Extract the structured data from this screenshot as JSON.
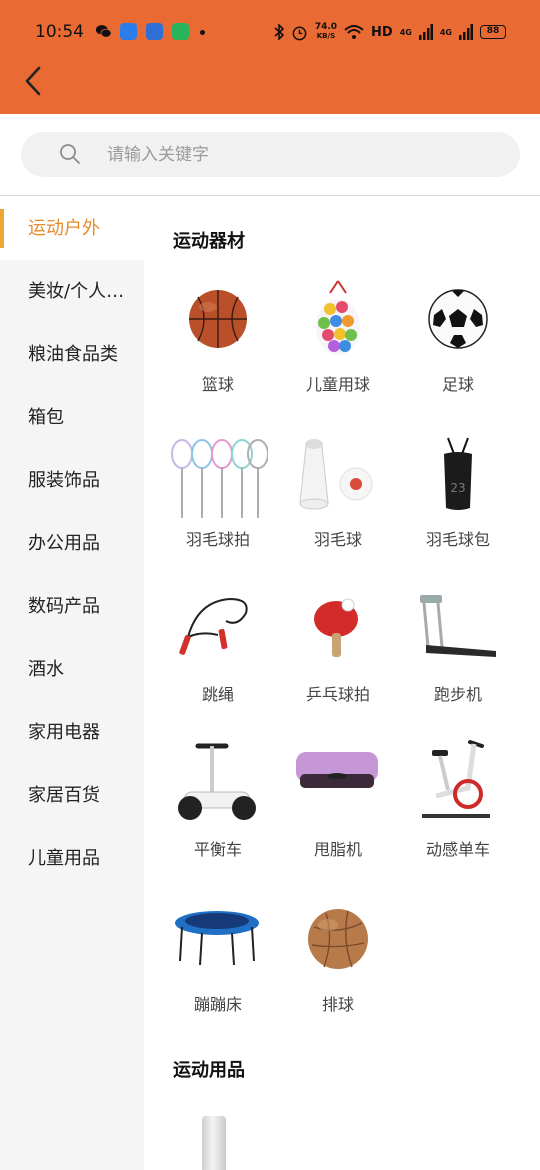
{
  "status_bar": {
    "time": "10:54",
    "net_speed_top": "74.0",
    "net_speed_bottom": "KB/S",
    "hd": "HD",
    "signal1": "4G",
    "signal2": "4G",
    "battery": "88"
  },
  "search": {
    "placeholder": "请输入关键字"
  },
  "sidebar": {
    "items": [
      {
        "label": "运动户外"
      },
      {
        "label": "美妆/个人…"
      },
      {
        "label": "粮油食品类"
      },
      {
        "label": "箱包"
      },
      {
        "label": "服装饰品"
      },
      {
        "label": "办公用品"
      },
      {
        "label": "数码产品"
      },
      {
        "label": "酒水"
      },
      {
        "label": "家用电器"
      },
      {
        "label": "家居百货"
      },
      {
        "label": "儿童用品"
      }
    ]
  },
  "sections": [
    {
      "title": "运动器材",
      "items": [
        {
          "label": "篮球",
          "icon": "basketball-icon"
        },
        {
          "label": "儿童用球",
          "icon": "kids-balls-icon"
        },
        {
          "label": "足球",
          "icon": "soccer-ball-icon"
        },
        {
          "label": "羽毛球拍",
          "icon": "badminton-racket-icon"
        },
        {
          "label": "羽毛球",
          "icon": "shuttlecock-icon"
        },
        {
          "label": "羽毛球包",
          "icon": "badminton-bag-icon"
        },
        {
          "label": "跳绳",
          "icon": "jump-rope-icon"
        },
        {
          "label": "乒乓球拍",
          "icon": "ping-pong-paddle-icon"
        },
        {
          "label": "跑步机",
          "icon": "treadmill-icon"
        },
        {
          "label": "平衡车",
          "icon": "balance-scooter-icon"
        },
        {
          "label": "甩脂机",
          "icon": "vibration-plate-icon"
        },
        {
          "label": "动感单车",
          "icon": "spin-bike-icon"
        },
        {
          "label": "蹦蹦床",
          "icon": "trampoline-icon"
        },
        {
          "label": "排球",
          "icon": "volleyball-icon"
        }
      ]
    },
    {
      "title": "运动用品"
    }
  ],
  "colors": {
    "header": "#ea6a33",
    "active_text": "#e98a2e",
    "active_bar": "#efa531"
  }
}
